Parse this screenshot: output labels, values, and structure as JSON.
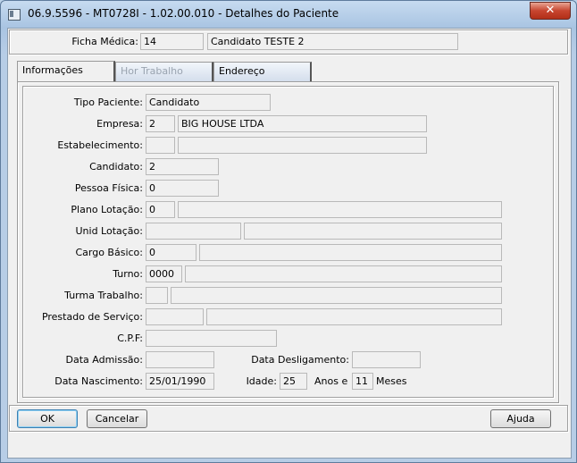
{
  "window": {
    "title": "06.9.5596 - MT0728I - 1.02.00.010 - Detalhes do Paciente",
    "close_glyph": "✕"
  },
  "header": {
    "ficha_label": "Ficha Médica:",
    "ficha_number": "14",
    "ficha_name": "Candidato TESTE 2"
  },
  "tabs": [
    {
      "label": "Informações",
      "state": "active"
    },
    {
      "label": "Hor Trabalho",
      "state": "disabled"
    },
    {
      "label": "Endereço",
      "state": "normal"
    }
  ],
  "form": {
    "tipo_paciente": {
      "label": "Tipo Paciente:",
      "value": "Candidato"
    },
    "empresa": {
      "label": "Empresa:",
      "code": "2",
      "name": "BIG HOUSE LTDA"
    },
    "estabelecimento": {
      "label": "Estabelecimento:",
      "code": "",
      "name": ""
    },
    "candidato": {
      "label": "Candidato:",
      "value": "2"
    },
    "pessoa_fisica": {
      "label": "Pessoa Física:",
      "value": "0"
    },
    "plano_lotacao": {
      "label": "Plano Lotação:",
      "code": "0",
      "name": ""
    },
    "unid_lotacao": {
      "label": "Unid Lotação:",
      "code": "",
      "name": ""
    },
    "cargo_basico": {
      "label": "Cargo Básico:",
      "code": "0",
      "name": ""
    },
    "turno": {
      "label": "Turno:",
      "code": "0000",
      "name": ""
    },
    "turma_trabalho": {
      "label": "Turma Trabalho:",
      "code": "",
      "name": ""
    },
    "prestado_servico": {
      "label": "Prestado de Serviço:",
      "code": "",
      "name": ""
    },
    "cpf": {
      "label": "C.P.F:",
      "value": ""
    },
    "data_admissao": {
      "label": "Data Admissão:",
      "value": ""
    },
    "data_desligamento": {
      "label": "Data Desligamento:",
      "value": ""
    },
    "data_nascimento": {
      "label": "Data Nascimento:",
      "value": "25/01/1990"
    },
    "idade": {
      "label": "Idade:",
      "anos": "25",
      "anos_label": "Anos e",
      "meses": "11",
      "meses_label": "Meses"
    }
  },
  "buttons": {
    "ok": "OK",
    "cancel": "Cancelar",
    "help": "Ajuda"
  }
}
